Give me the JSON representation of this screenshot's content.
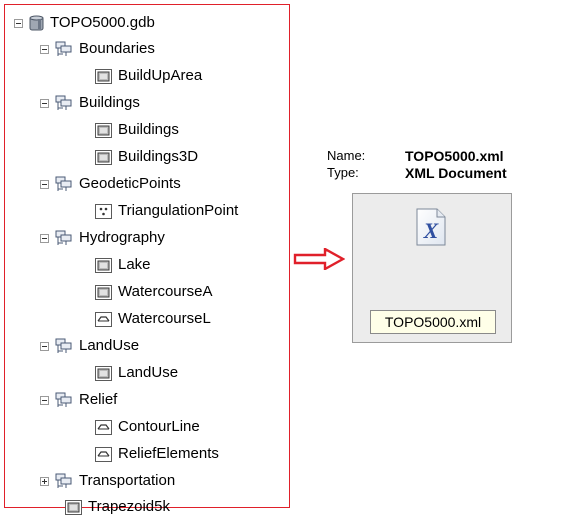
{
  "tree": {
    "root": "TOPO5000.gdb",
    "items": [
      {
        "label": "Boundaries",
        "kind": "dataset",
        "expanded": true
      },
      {
        "label": "BuildUpArea",
        "kind": "polygon"
      },
      {
        "label": "Buildings",
        "kind": "dataset",
        "expanded": true
      },
      {
        "label": "Buildings",
        "kind": "polygon"
      },
      {
        "label": "Buildings3D",
        "kind": "polygon"
      },
      {
        "label": "GeodeticPoints",
        "kind": "dataset",
        "expanded": true
      },
      {
        "label": "TriangulationPoint",
        "kind": "point"
      },
      {
        "label": "Hydrography",
        "kind": "dataset",
        "expanded": true
      },
      {
        "label": "Lake",
        "kind": "polygon"
      },
      {
        "label": "WatercourseA",
        "kind": "polygon"
      },
      {
        "label": "WatercourseL",
        "kind": "line"
      },
      {
        "label": "LandUse",
        "kind": "dataset",
        "expanded": true
      },
      {
        "label": "LandUse",
        "kind": "polygon"
      },
      {
        "label": "Relief",
        "kind": "dataset",
        "expanded": true
      },
      {
        "label": "ContourLine",
        "kind": "line"
      },
      {
        "label": "ReliefElements",
        "kind": "line"
      },
      {
        "label": "Transportation",
        "kind": "dataset",
        "expanded": false
      },
      {
        "label": "Trapezoid5k",
        "kind": "polygon"
      }
    ]
  },
  "file_info": {
    "name_key": "Name:",
    "name_value": "TOPO5000.xml",
    "type_key": "Type:",
    "type_value": "XML Document",
    "file_label": "TOPO5000.xml"
  },
  "colors": {
    "panel_border": "#e0202a",
    "arrow": "#e0202a",
    "card_bg": "#ececec",
    "label_bg": "#ffffe8"
  },
  "icons": {
    "database": "geodatabase-icon",
    "dataset": "feature-dataset-icon",
    "polygon": "polygon-feature-class-icon",
    "point": "point-feature-class-icon",
    "line": "line-feature-class-icon",
    "file": "xml-file-icon",
    "arrow": "right-arrow-icon"
  }
}
